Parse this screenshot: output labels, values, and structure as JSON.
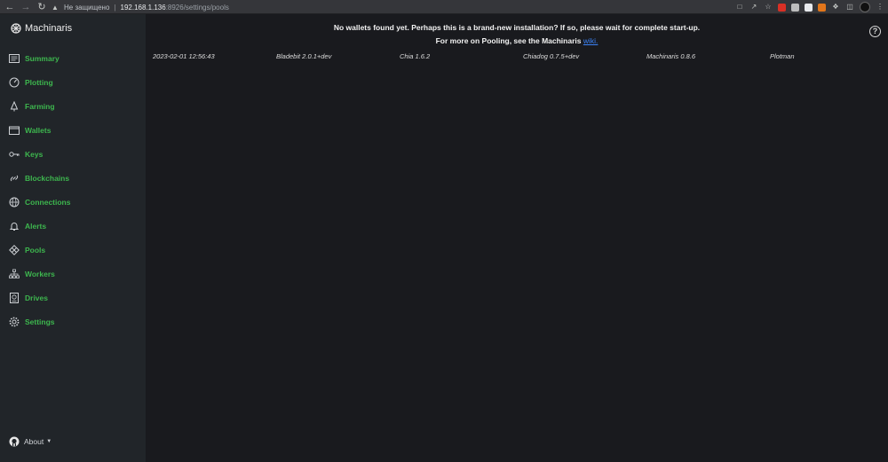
{
  "browser": {
    "security_label": "Не защищено",
    "host": "192.168.1.136",
    "path": ":8926/settings/pools"
  },
  "brand": {
    "name": "Machinaris"
  },
  "sidebar": {
    "items": [
      {
        "label": "Summary",
        "icon": "summary-icon"
      },
      {
        "label": "Plotting",
        "icon": "speedometer-icon"
      },
      {
        "label": "Farming",
        "icon": "tree-icon"
      },
      {
        "label": "Wallets",
        "icon": "wallet-icon"
      },
      {
        "label": "Keys",
        "icon": "key-icon"
      },
      {
        "label": "Blockchains",
        "icon": "link-icon"
      },
      {
        "label": "Connections",
        "icon": "globe-icon"
      },
      {
        "label": "Alerts",
        "icon": "bell-icon"
      },
      {
        "label": "Pools",
        "icon": "diamond-icon"
      },
      {
        "label": "Workers",
        "icon": "diagram-icon"
      },
      {
        "label": "Drives",
        "icon": "drive-icon"
      },
      {
        "label": "Settings",
        "icon": "gear-icon"
      }
    ],
    "about_label": "About"
  },
  "main": {
    "message_line1": "No wallets found yet. Perhaps this is a brand-new installation? If so, please wait for complete start-up.",
    "message_line2_prefix": "For more on Pooling, see the Machinaris ",
    "wiki_link": "wiki.",
    "help_glyph": "?",
    "versions": [
      "2023-02-01 12:56:43",
      "Bladebit 2.0.1+dev",
      "Chia 1.6.2",
      "Chiadog 0.7.5+dev",
      "Machinaris 0.8.6",
      "Plotman"
    ]
  },
  "colors": {
    "accent_green": "#3db64e",
    "sidebar_bg": "#212529",
    "main_bg": "#191a1e",
    "link_blue": "#3b82f6"
  }
}
